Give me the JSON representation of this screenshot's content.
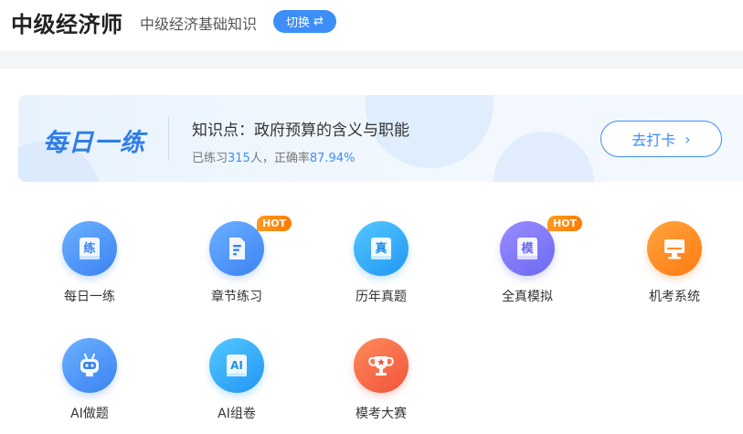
{
  "header": {
    "app_title": "中级经济师",
    "subject": "中级经济基础知识",
    "switch_label": "切换",
    "switch_icon": "⇄"
  },
  "banner": {
    "logo_text": "每日一练",
    "topic": "知识点：政府预算的含义与职能",
    "stats_prefix": "已练习",
    "practiced_count": "315",
    "stats_mid": "人，正确率",
    "accuracy": "87.94%",
    "checkin_label": "去打卡",
    "checkin_icon": "›"
  },
  "features": [
    {
      "label": "每日一练",
      "icon": "练",
      "hot": ""
    },
    {
      "label": "章节练习",
      "icon": "document-icon",
      "hot": "HOT"
    },
    {
      "label": "历年真题",
      "icon": "真",
      "hot": ""
    },
    {
      "label": "全真模拟",
      "icon": "模",
      "hot": "HOT"
    },
    {
      "label": "机考系统",
      "icon": "computer-icon",
      "hot": ""
    },
    {
      "label": "AI做题",
      "icon": "robot-icon",
      "hot": ""
    },
    {
      "label": "AI组卷",
      "icon": "AI",
      "hot": ""
    },
    {
      "label": "模考大赛",
      "icon": "trophy-icon",
      "hot": ""
    }
  ],
  "colors": {
    "accent": "#3d8ef7",
    "hot": "#ff8a00"
  }
}
